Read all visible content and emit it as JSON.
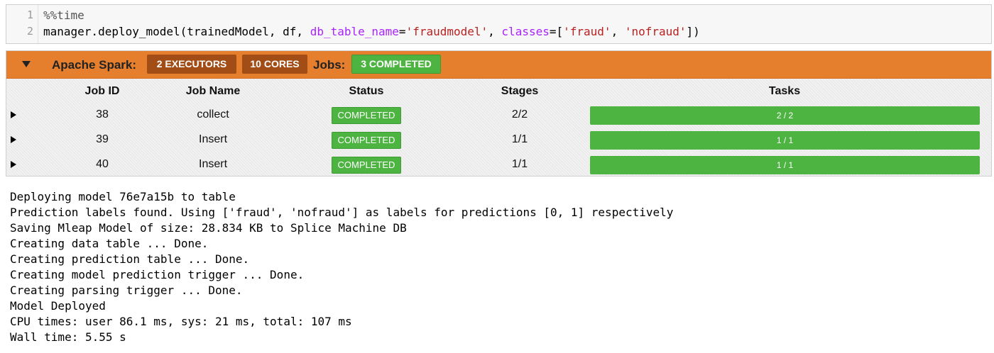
{
  "code": {
    "line_numbers": [
      "1",
      "2"
    ],
    "line1": "%%time",
    "line2": {
      "fn": "manager.deploy_model(trainedModel, df, ",
      "kw1": "db_table_name",
      "eq1": "=",
      "str1": "'fraudmodel'",
      "sep": ", ",
      "kw2": "classes",
      "eq2": "=[",
      "str2": "'fraud'",
      "comma": ", ",
      "str3": "'nofraud'",
      "close": "])"
    }
  },
  "spark": {
    "label": "Apache Spark:",
    "executors": "2 EXECUTORS",
    "cores": "10 CORES",
    "jobs_label": "Jobs:",
    "jobs_status": "3 COMPLETED",
    "colors": {
      "header": "#e57f2e",
      "badge_dark": "#a34d16",
      "green": "#4db442"
    },
    "table": {
      "headers": [
        "Job ID",
        "Job Name",
        "Status",
        "Stages",
        "Tasks"
      ],
      "rows": [
        {
          "id": "38",
          "name": "collect",
          "status": "COMPLETED",
          "stages": "2/2",
          "tasks": "2 / 2",
          "progress": 1.0
        },
        {
          "id": "39",
          "name": "Insert",
          "status": "COMPLETED",
          "stages": "1/1",
          "tasks": "1 / 1",
          "progress": 1.0
        },
        {
          "id": "40",
          "name": "Insert",
          "status": "COMPLETED",
          "stages": "1/1",
          "tasks": "1 / 1",
          "progress": 1.0
        }
      ]
    }
  },
  "output": [
    "Deploying model 76e7a15b to table",
    "Prediction labels found. Using ['fraud', 'nofraud'] as labels for predictions [0, 1] respectively",
    "Saving Mleap Model of size: 28.834 KB to Splice Machine DB",
    "Creating data table ... Done.",
    "Creating prediction table ... Done.",
    "Creating model prediction trigger ... Done.",
    "Creating parsing trigger ... Done.",
    "Model Deployed",
    "CPU times: user 86.1 ms, sys: 21 ms, total: 107 ms",
    "Wall time: 5.55 s"
  ]
}
